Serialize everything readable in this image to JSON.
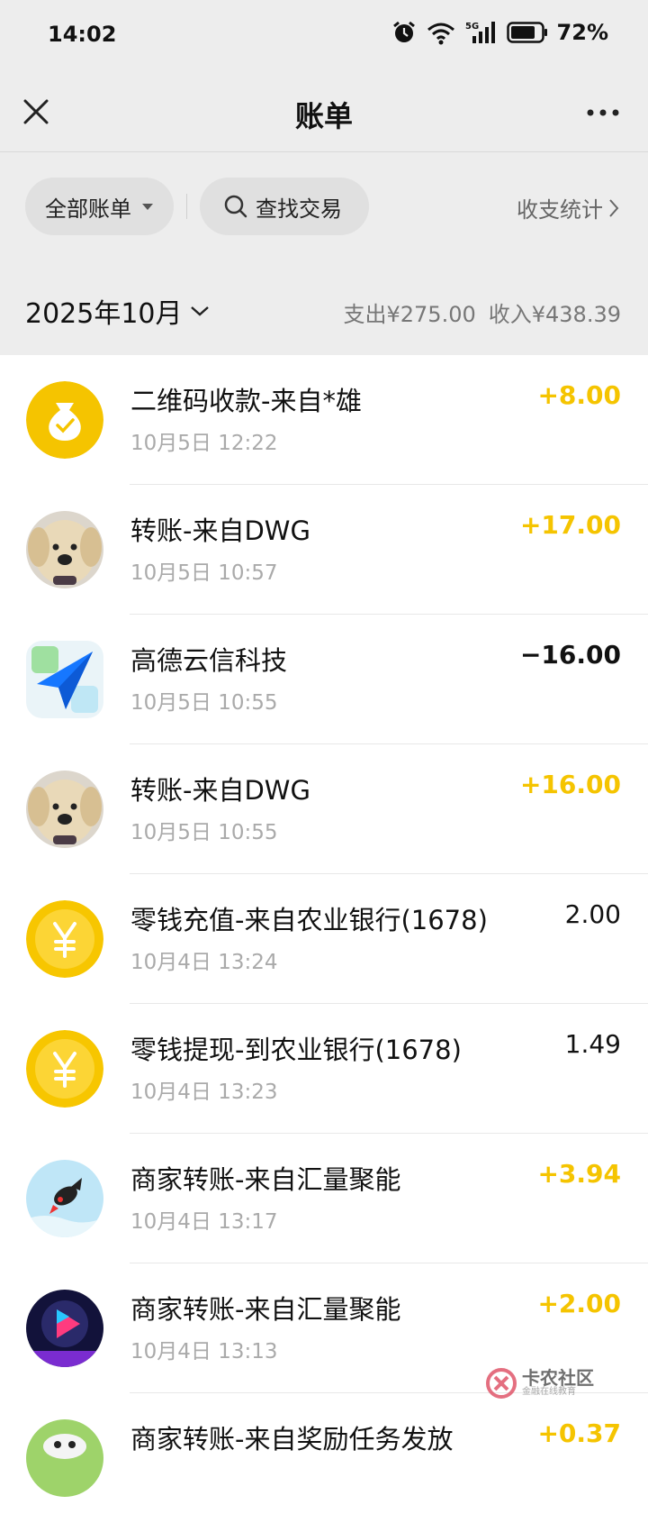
{
  "status_bar": {
    "time": "14:02",
    "network": "5G",
    "battery": "72%",
    "icons": [
      "alarm-icon",
      "wifi-icon",
      "signal-icon",
      "battery-icon"
    ]
  },
  "nav": {
    "title": "账单",
    "icons": [
      "close-icon",
      "more-icon"
    ]
  },
  "filters": {
    "all_bills": "全部账单",
    "search": "查找交易",
    "stats": "收支统计"
  },
  "summary": {
    "month": "2025年10月",
    "expense": "支出¥275.00",
    "income": "收入¥438.39"
  },
  "colors": {
    "income_accent": "#f5c400",
    "background_gray": "#ededed",
    "text_primary": "#111111",
    "text_secondary": "#aaaaaa"
  },
  "transactions": [
    {
      "title": "二维码收款-来自*雄",
      "time": "10月5日 12:22",
      "amount": "+8.00",
      "kind": "in",
      "icon": "money-bag-icon"
    },
    {
      "title": "转账-来自DWG",
      "time": "10月5日 10:57",
      "amount": "+17.00",
      "kind": "in",
      "icon": "dog-avatar"
    },
    {
      "title": "高德云信科技",
      "time": "10月5日 10:55",
      "amount": "−16.00",
      "kind": "out",
      "icon": "amap-icon"
    },
    {
      "title": "转账-来自DWG",
      "time": "10月5日 10:55",
      "amount": "+16.00",
      "kind": "in",
      "icon": "dog-avatar"
    },
    {
      "title": "零钱充值-来自农业银行(1678)",
      "time": "10月4日 13:24",
      "amount": "2.00",
      "kind": "neutral",
      "icon": "yuan-coin-icon"
    },
    {
      "title": "零钱提现-到农业银行(1678)",
      "time": "10月4日 13:23",
      "amount": "1.49",
      "kind": "neutral",
      "icon": "yuan-coin-icon"
    },
    {
      "title": "商家转账-来自汇量聚能",
      "time": "10月4日 13:17",
      "amount": "+3.94",
      "kind": "in",
      "icon": "fish-avatar"
    },
    {
      "title": "商家转账-来自汇量聚能",
      "time": "10月4日 13:13",
      "amount": "+2.00",
      "kind": "in",
      "icon": "video-play-avatar"
    },
    {
      "title": "商家转账-来自奖励任务发放",
      "time": "",
      "amount": "+0.37",
      "kind": "in",
      "icon": "cartoon-avatar"
    }
  ],
  "watermark": {
    "title": "卡农社区",
    "subtitle": "金融在线教育"
  }
}
